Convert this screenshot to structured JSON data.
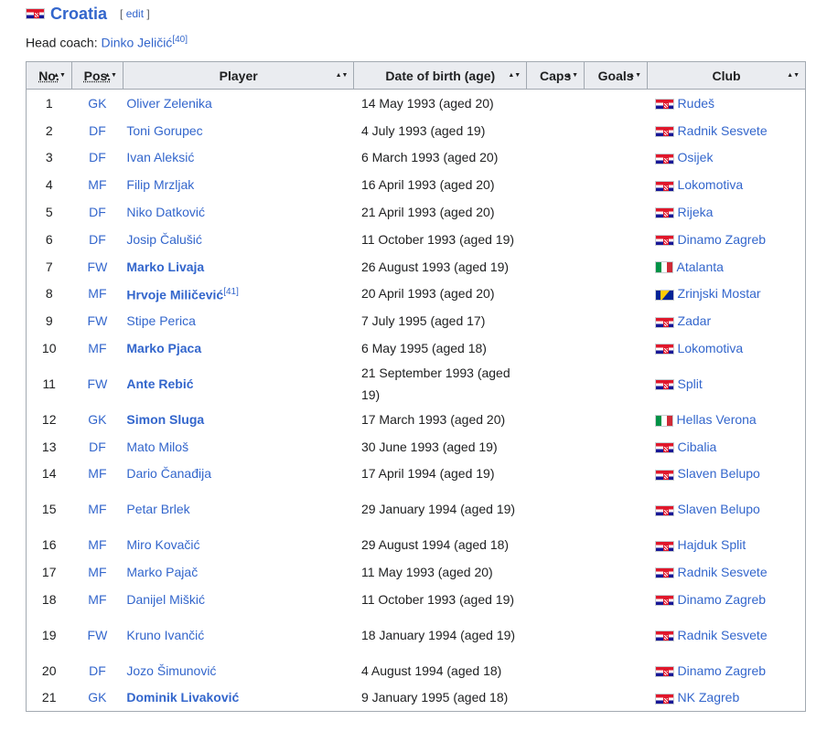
{
  "section": {
    "title": "Croatia",
    "edit_open": "[",
    "edit_label": "edit",
    "edit_close": "]"
  },
  "coach": {
    "label": "Head coach: ",
    "name": "Dinko Jeličić",
    "ref": "[40]"
  },
  "headers": {
    "no": "No.",
    "pos": "Pos.",
    "player": "Player",
    "dob": "Date of birth (age)",
    "caps": "Caps",
    "goals": "Goals",
    "club": "Club"
  },
  "rows": [
    {
      "no": "1",
      "pos": "GK",
      "player": "Oliver Zelenika",
      "bold": false,
      "ref": "",
      "dob": "14 May 1993 (aged 20)",
      "flag": "hr",
      "club": "Rudeš",
      "tall": false
    },
    {
      "no": "2",
      "pos": "DF",
      "player": "Toni Gorupec",
      "bold": false,
      "ref": "",
      "dob": "4 July 1993 (aged 19)",
      "flag": "hr",
      "club": "Radnik Sesvete",
      "tall": false
    },
    {
      "no": "3",
      "pos": "DF",
      "player": "Ivan Aleksić",
      "bold": false,
      "ref": "",
      "dob": "6 March 1993 (aged 20)",
      "flag": "hr",
      "club": "Osijek",
      "tall": false
    },
    {
      "no": "4",
      "pos": "MF",
      "player": "Filip Mrzljak",
      "bold": false,
      "ref": "",
      "dob": "16 April 1993 (aged 20)",
      "flag": "hr",
      "club": "Lokomotiva",
      "tall": false
    },
    {
      "no": "5",
      "pos": "DF",
      "player": "Niko Datković",
      "bold": false,
      "ref": "",
      "dob": "21 April 1993 (aged 20)",
      "flag": "hr",
      "club": "Rijeka",
      "tall": false
    },
    {
      "no": "6",
      "pos": "DF",
      "player": "Josip Čalušić",
      "bold": false,
      "ref": "",
      "dob": "11 October 1993 (aged 19)",
      "flag": "hr",
      "club": "Dinamo Zagreb",
      "tall": false
    },
    {
      "no": "7",
      "pos": "FW",
      "player": "Marko Livaja",
      "bold": true,
      "ref": "",
      "dob": "26 August 1993 (aged 19)",
      "flag": "it",
      "club": "Atalanta",
      "tall": false
    },
    {
      "no": "8",
      "pos": "MF",
      "player": "Hrvoje Miličević",
      "bold": true,
      "ref": "[41]",
      "dob": "20 April 1993 (aged 20)",
      "flag": "ba",
      "club": "Zrinjski Mostar",
      "tall": false
    },
    {
      "no": "9",
      "pos": "FW",
      "player": "Stipe Perica",
      "bold": false,
      "ref": "",
      "dob": "7 July 1995 (aged 17)",
      "flag": "hr",
      "club": "Zadar",
      "tall": false
    },
    {
      "no": "10",
      "pos": "MF",
      "player": "Marko Pjaca",
      "bold": true,
      "ref": "",
      "dob": "6 May 1995 (aged 18)",
      "flag": "hr",
      "club": "Lokomotiva",
      "tall": false
    },
    {
      "no": "11",
      "pos": "FW",
      "player": "Ante Rebić",
      "bold": true,
      "ref": "",
      "dob": "21 September 1993 (aged 19)",
      "flag": "hr",
      "club": "Split",
      "tall": true
    },
    {
      "no": "12",
      "pos": "GK",
      "player": "Simon Sluga",
      "bold": true,
      "ref": "",
      "dob": "17 March 1993 (aged 20)",
      "flag": "it",
      "club": "Hellas Verona",
      "tall": false
    },
    {
      "no": "13",
      "pos": "DF",
      "player": "Mato Miloš",
      "bold": false,
      "ref": "",
      "dob": "30 June 1993 (aged 19)",
      "flag": "hr",
      "club": "Cibalia",
      "tall": false
    },
    {
      "no": "14",
      "pos": "MF",
      "player": "Dario Čanađija",
      "bold": false,
      "ref": "",
      "dob": "17 April 1994 (aged 19)",
      "flag": "hr",
      "club": "Slaven Belupo",
      "tall": false
    },
    {
      "no": "15",
      "pos": "MF",
      "player": "Petar Brlek",
      "bold": false,
      "ref": "",
      "dob": "29 January 1994 (aged 19)",
      "flag": "hr",
      "club": "Slaven Belupo",
      "tall": true
    },
    {
      "no": "16",
      "pos": "MF",
      "player": "Miro Kovačić",
      "bold": false,
      "ref": "",
      "dob": "29 August 1994 (aged 18)",
      "flag": "hr",
      "club": "Hajduk Split",
      "tall": false
    },
    {
      "no": "17",
      "pos": "MF",
      "player": "Marko Pajač",
      "bold": false,
      "ref": "",
      "dob": "11 May 1993 (aged 20)",
      "flag": "hr",
      "club": "Radnik Sesvete",
      "tall": false
    },
    {
      "no": "18",
      "pos": "MF",
      "player": "Danijel Miškić",
      "bold": false,
      "ref": "",
      "dob": "11 October 1993 (aged 19)",
      "flag": "hr",
      "club": "Dinamo Zagreb",
      "tall": false
    },
    {
      "no": "19",
      "pos": "FW",
      "player": "Kruno Ivančić",
      "bold": false,
      "ref": "",
      "dob": "18 January 1994 (aged 19)",
      "flag": "hr",
      "club": "Radnik Sesvete",
      "tall": true
    },
    {
      "no": "20",
      "pos": "DF",
      "player": "Jozo Šimunović",
      "bold": false,
      "ref": "",
      "dob": "4 August 1994 (aged 18)",
      "flag": "hr",
      "club": "Dinamo Zagreb",
      "tall": false
    },
    {
      "no": "21",
      "pos": "GK",
      "player": "Dominik Livaković",
      "bold": true,
      "ref": "",
      "dob": "9 January 1995 (aged 18)",
      "flag": "hr",
      "club": "NK Zagreb",
      "tall": false
    }
  ]
}
